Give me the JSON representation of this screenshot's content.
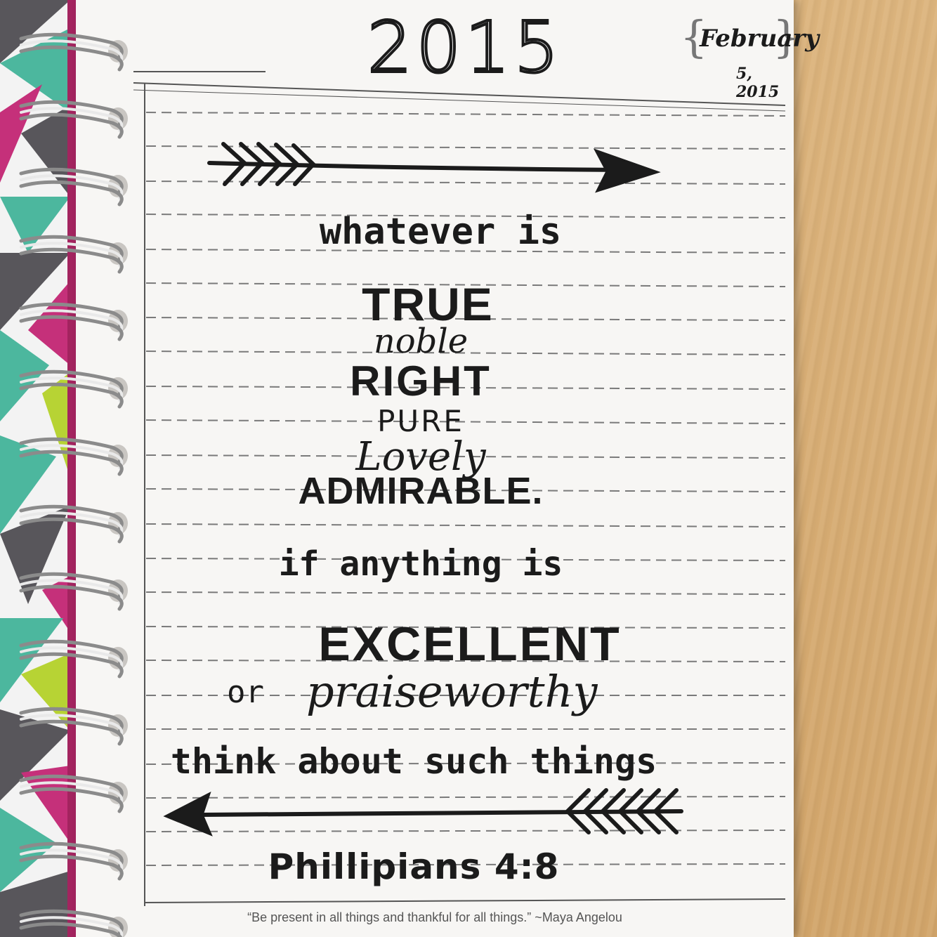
{
  "journal": {
    "year": "2015",
    "month": "February",
    "date": "5, 2015"
  },
  "quote": {
    "line1": "whatever is",
    "word_true": "TRUE",
    "word_noble": "noble",
    "word_right": "RIGHT",
    "word_pure": "PURE",
    "word_lovely": "Lovely",
    "word_admirable": "ADMIRABLE.",
    "line2": "if anything is",
    "word_excellent": "EXCELLENT",
    "word_or": "or",
    "word_praiseworthy": "praiseworthy",
    "line3": "think about such things",
    "reference": "Phillipians 4:8"
  },
  "footer": {
    "printed_quote": "“Be present in all things and thankful for all things.” ~Maya Angelou"
  },
  "colors": {
    "desk": "#d9b27a",
    "paper": "#f7f6f4",
    "ink": "#1b1b1b",
    "cover_accent": "#a3245f",
    "cover_teal": "#4cb79e",
    "cover_pink": "#c5307a",
    "cover_gray": "#58565b",
    "cover_lime": "#b7d334"
  },
  "icons": [
    "spiral-binding-icon",
    "arrow-right-icon",
    "arrow-left-icon"
  ]
}
